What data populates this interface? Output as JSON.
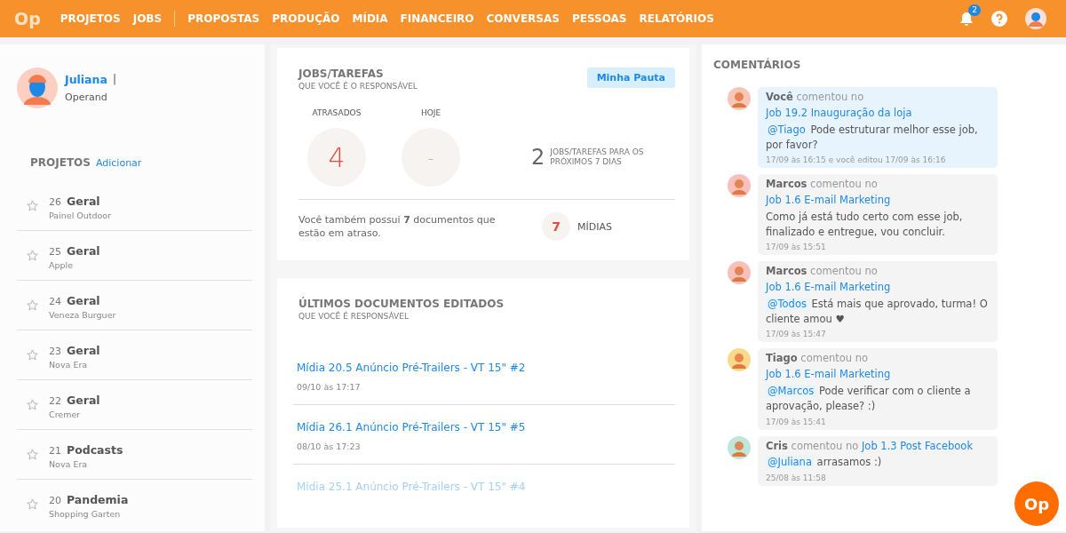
{
  "header": {
    "logo": "Op",
    "nav_groups": [
      [
        "PROJETOS",
        "JOBS"
      ],
      [
        "PROPOSTAS",
        "PRODUÇÃO",
        "MÍDIA",
        "FINANCEIRO",
        "CONVERSAS",
        "PESSOAS",
        "RELATÓRIOS"
      ]
    ],
    "notifications": "2"
  },
  "user": {
    "name": "Juliana",
    "separator": "|",
    "company": "Operand"
  },
  "projects": {
    "title": "PROJETOS",
    "add": "Adicionar",
    "items": [
      {
        "number": "26",
        "name": "Geral",
        "client": "Painel Outdoor",
        "starred": false
      },
      {
        "number": "25",
        "name": "Geral",
        "client": "Apple",
        "starred": false
      },
      {
        "number": "24",
        "name": "Geral",
        "client": "Veneza Burguer",
        "starred": false
      },
      {
        "number": "23",
        "name": "Geral",
        "client": "Nova Era",
        "starred": false
      },
      {
        "number": "22",
        "name": "Geral",
        "client": "Cremer",
        "starred": false
      },
      {
        "number": "21",
        "name": "Podcasts",
        "client": "Nova Era",
        "starred": false
      },
      {
        "number": "20",
        "name": "Pandemia",
        "client": "Shopping Garten",
        "starred": false
      }
    ]
  },
  "jobs": {
    "title": "JOBS/TAREFAS",
    "subtitle": "QUE VOCÊ É O RESPONSÁVEL",
    "button": "Minha Pauta",
    "stats": [
      {
        "label": "ATRASADOS",
        "value": "4",
        "kind": "late"
      },
      {
        "label": "HOJE",
        "value": "-",
        "kind": "today"
      }
    ],
    "upcoming": {
      "value": "2",
      "label": "JOBS/TAREFAS PARA OS PRÓXIMOS 7 DIAS"
    },
    "late_docs": "Você também possui **7** documentos que estão em atraso.",
    "media": {
      "value": "7",
      "label": "MÍDIAS"
    }
  },
  "documents": {
    "title": "ÚLTIMOS DOCUMENTOS EDITADOS",
    "subtitle": "QUE VOCÊ É RESPONSÁVEL",
    "items": [
      {
        "title": "Mídia 20.5 Anúncio Pré-Trailers - VT 15\" #2",
        "date": "09/10 às 17:17",
        "faded": false
      },
      {
        "title": "Mídia 26.1 Anúncio Pré-Trailers - VT 15\" #5",
        "date": "08/10 às 17:23",
        "faded": false
      },
      {
        "title": "Mídia 25.1 Anúncio Pré-Trailers - VT 15\" #4",
        "faded": true
      }
    ]
  },
  "comments": {
    "title": "COMENTÁRIOS",
    "items": [
      {
        "author": "Você",
        "verb": "comentou no",
        "job": "Job 19.2 Inauguração da loja",
        "mention": "@Tiago",
        "text": "Pode estruturar melhor esse job, por favor?",
        "time": "17/09 às 16:15 e você editou 17/09 às 16:16",
        "highlighted": true,
        "color": "#f7c6b8"
      },
      {
        "author": "Marcos",
        "verb": "comentou no",
        "job": "Job 1.6 E-mail Marketing",
        "text": "Como já está tudo certo com esse job, finalizado e entregue, vou concluir.",
        "time": "17/09 às 15:51",
        "highlighted": false,
        "color": "#f7c0bb"
      },
      {
        "author": "Marcos",
        "verb": "comentou no",
        "job": "Job 1.6 E-mail Marketing",
        "mention": "@Todos",
        "text": "Está mais que aprovado, turma! O cliente amou ♥",
        "time": "17/09 às 15:47",
        "highlighted": false,
        "color": "#f7c0bb"
      },
      {
        "author": "Tiago",
        "verb": "comentou no",
        "job": "Job 1.6 E-mail Marketing",
        "mention": "@Marcos",
        "text": "Pode verificar com o cliente a aprovação, please? :)",
        "time": "17/09 às 15:41",
        "highlighted": false,
        "color": "#fbd98a"
      },
      {
        "author": "Cris",
        "verb": "comentou no",
        "job": "Job 1.3 Post Facebook",
        "mention": "@Juliana",
        "text": "arrasamos :)",
        "time": "25/08 às 11:58",
        "highlighted": false,
        "color": "#bfe6da"
      }
    ]
  },
  "fab": "Op"
}
